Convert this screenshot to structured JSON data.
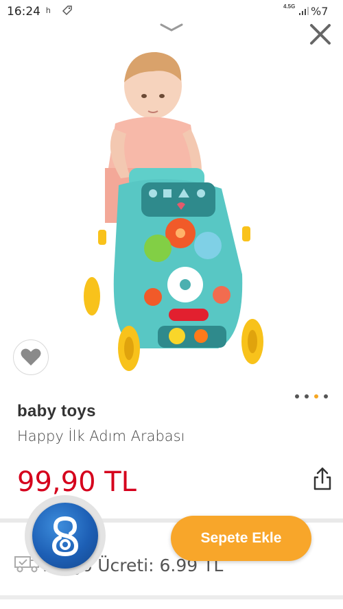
{
  "status_bar": {
    "time": "16:24",
    "indicator": "h",
    "network": "4.5G",
    "battery": "%7"
  },
  "product": {
    "brand": "baby toys",
    "name": "Happy İlk Adım Arabası",
    "price": "99,90 TL",
    "image_icon": "baby-walker-toy-photo"
  },
  "carousel": {
    "dots": 4,
    "active_index": 2
  },
  "actions": {
    "add_to_cart_label": "Sepete Ekle"
  },
  "shipping": {
    "text": "Kargo Ücreti:  6.99 TL"
  },
  "colors": {
    "price": "#d5001c",
    "cta": "#f8a62a",
    "active_dot": "#f5a623",
    "assistant": "#1d5fb5"
  },
  "icons": [
    "chevron-down-icon",
    "close-icon",
    "heart-icon",
    "share-icon",
    "truck-icon",
    "assistant-logo-icon"
  ]
}
